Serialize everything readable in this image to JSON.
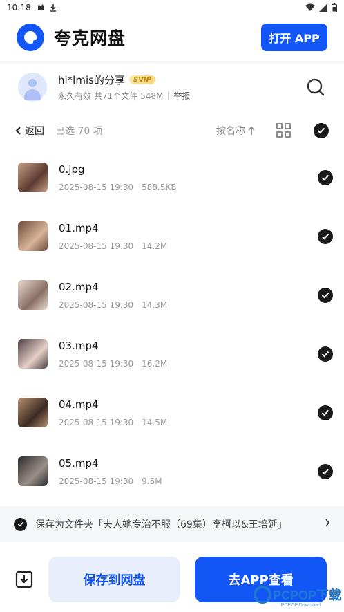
{
  "status_bar": {
    "time": "10:18"
  },
  "app_bar": {
    "app_name": "夸克网盘",
    "open_app_label": "打开 APP"
  },
  "share": {
    "title": "hi*lmis的分享",
    "badge": "SVIP",
    "validity": "永久有效",
    "summary": "共71个文件 548M",
    "report_label": "举报"
  },
  "toolbar": {
    "back_label": "返回",
    "selected_label": "已选 70 项",
    "sort_label": "按名称"
  },
  "files": [
    {
      "name": "0.jpg",
      "date": "2025-08-15 19:30",
      "size": "588.5KB",
      "thumb_color": "#c9a089",
      "thumb_color2": "#5a3b30"
    },
    {
      "name": "01.mp4",
      "date": "2025-08-15 19:30",
      "size": "14.2M",
      "thumb_color": "#6b4a3a",
      "thumb_color2": "#d8b49a"
    },
    {
      "name": "02.mp4",
      "date": "2025-08-15 19:30",
      "size": "14.3M",
      "thumb_color": "#e9d9cf",
      "thumb_color2": "#8a6f63"
    },
    {
      "name": "03.mp4",
      "date": "2025-08-15 19:30",
      "size": "16.2M",
      "thumb_color": "#4b3f44",
      "thumb_color2": "#e6cfc6"
    },
    {
      "name": "04.mp4",
      "date": "2025-08-15 19:30",
      "size": "14.5M",
      "thumb_color": "#b6916f",
      "thumb_color2": "#3b2a22"
    },
    {
      "name": "05.mp4",
      "date": "2025-08-15 19:30",
      "size": "9.5M",
      "thumb_color": "#2b2a2c",
      "thumb_color2": "#9a8f88"
    }
  ],
  "folder_bar": {
    "text": "保存为文件夹「夫人她专治不服（69集）李柯以&王培延」"
  },
  "bottom": {
    "save_label": "保存到网盘",
    "go_app_label": "去APP查看"
  },
  "watermark": {
    "text": "PCPOP下载",
    "sub": "PCPOP Download"
  },
  "colors": {
    "accent": "#1257f5",
    "accent_light": "#e8eefc"
  }
}
